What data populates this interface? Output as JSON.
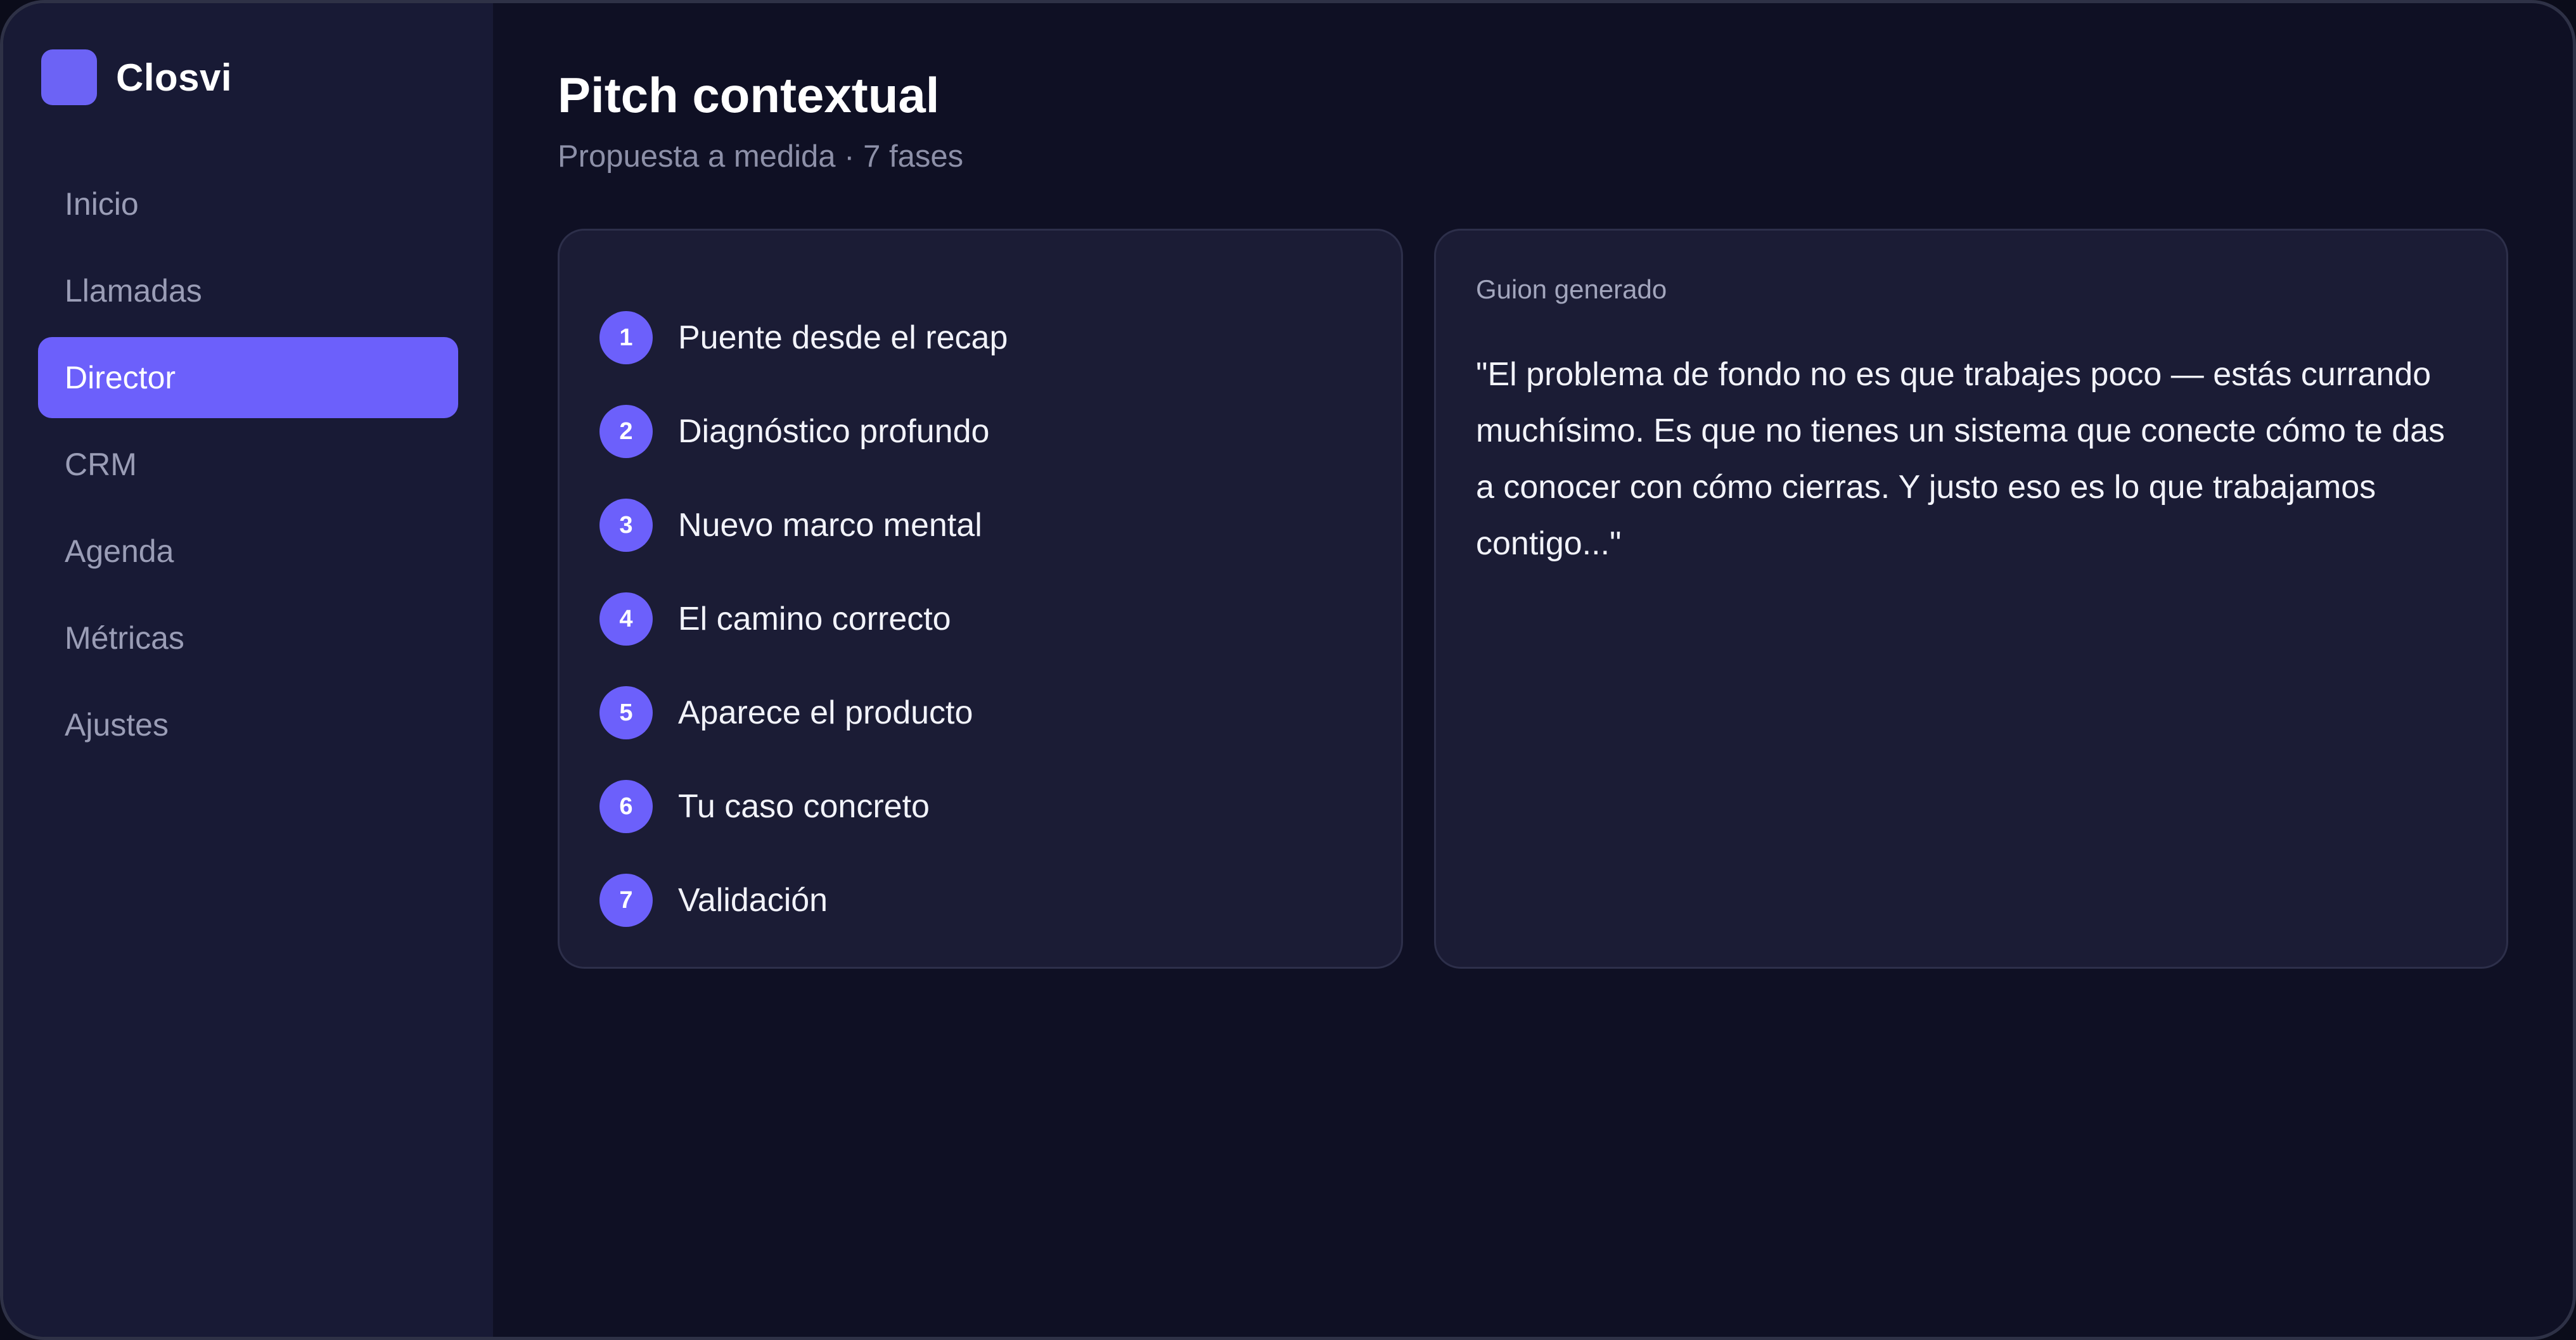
{
  "brand": {
    "name": "Closvi",
    "accent": "#6c60fb"
  },
  "sidebar": {
    "items": [
      {
        "label": "Inicio",
        "active": false
      },
      {
        "label": "Llamadas",
        "active": false
      },
      {
        "label": "Director",
        "active": true
      },
      {
        "label": "CRM",
        "active": false
      },
      {
        "label": "Agenda",
        "active": false
      },
      {
        "label": "Métricas",
        "active": false
      },
      {
        "label": "Ajustes",
        "active": false
      }
    ]
  },
  "main": {
    "title": "Pitch contextual",
    "subtitle": "Propuesta a medida · 7 fases",
    "steps": [
      {
        "num": "1",
        "label": "Puente desde el recap"
      },
      {
        "num": "2",
        "label": "Diagnóstico profundo"
      },
      {
        "num": "3",
        "label": "Nuevo marco mental"
      },
      {
        "num": "4",
        "label": "El camino correcto"
      },
      {
        "num": "5",
        "label": "Aparece el producto"
      },
      {
        "num": "6",
        "label": "Tu caso concreto"
      },
      {
        "num": "7",
        "label": "Validación"
      }
    ],
    "script": {
      "label": "Guion generado",
      "text": "\"El problema de fondo no es que trabajes poco — estás currando muchísimo. Es que no tienes un sistema que conecte cómo te das a conocer con cómo cierras. Y justo eso es lo que trabajamos contigo...\""
    }
  }
}
